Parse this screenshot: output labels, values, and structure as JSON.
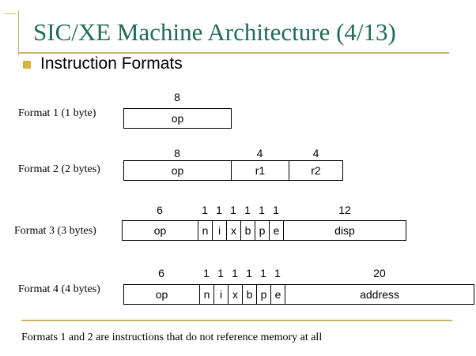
{
  "title": "SIC/XE Machine Architecture (4/13)",
  "bullet": "Instruction Formats",
  "formats": [
    {
      "label": "Format 1 (1 byte)",
      "bits": [
        "8"
      ],
      "fields": [
        "op"
      ]
    },
    {
      "label": "Format 2 (2 bytes)",
      "bits": [
        "8",
        "4",
        "4"
      ],
      "fields": [
        "op",
        "r1",
        "r2"
      ]
    },
    {
      "label": "Format 3 (3 bytes)",
      "bits": [
        "6",
        "1",
        "1",
        "1",
        "1",
        "1",
        "1",
        "12"
      ],
      "fields": [
        "op",
        "n",
        "i",
        "x",
        "b",
        "p",
        "e",
        "disp"
      ]
    },
    {
      "label": "Format 4 (4 bytes)",
      "bits": [
        "6",
        "1",
        "1",
        "1",
        "1",
        "1",
        "1",
        "20"
      ],
      "fields": [
        "op",
        "n",
        "i",
        "x",
        "b",
        "p",
        "e",
        "address"
      ]
    }
  ],
  "footer": "Formats 1 and 2 are instructions that do not reference memory at all",
  "colors": {
    "title": "#1f6b57",
    "accent_line": "#c8b36e",
    "bullet": "#d9b33a"
  }
}
